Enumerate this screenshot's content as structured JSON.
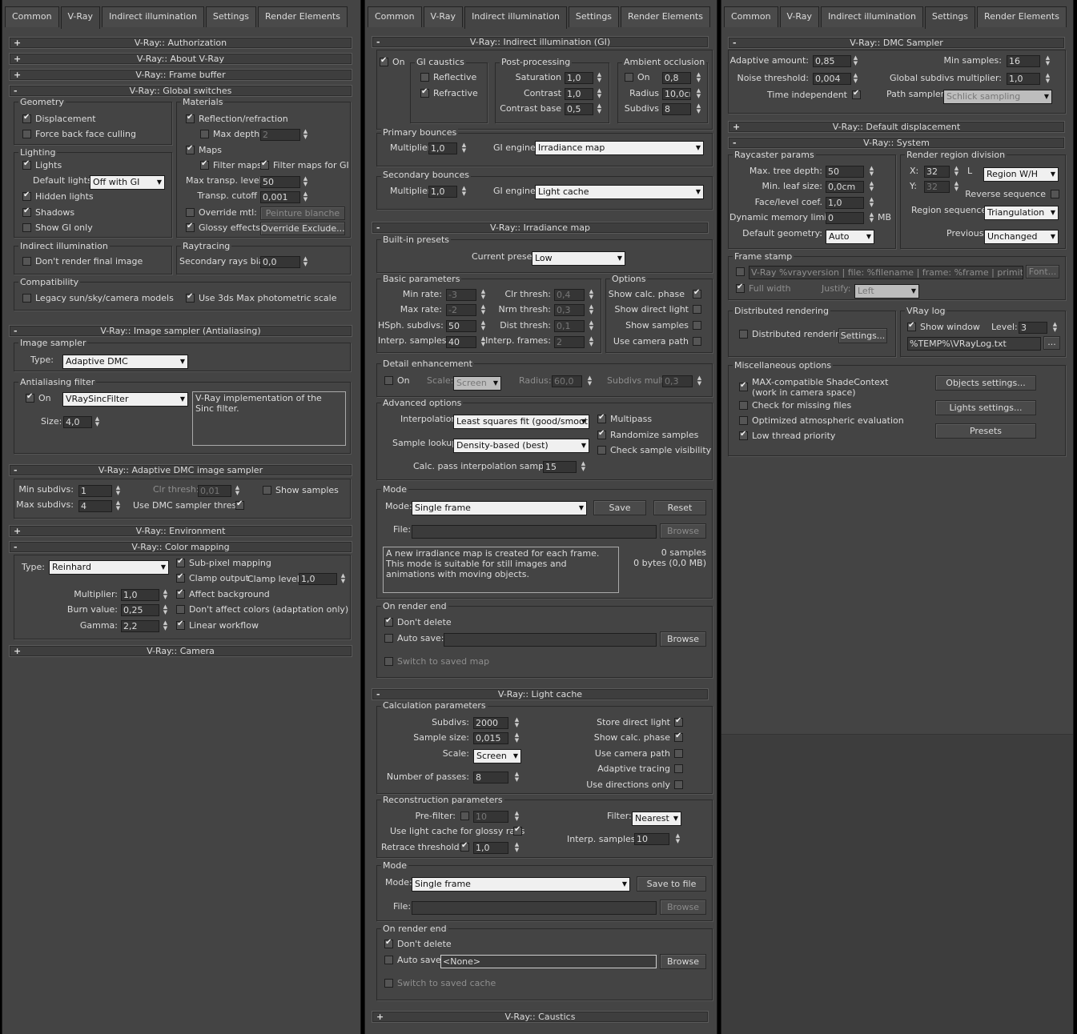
{
  "tabs": [
    "Common",
    "V-Ray",
    "Indirect illumination",
    "Settings",
    "Render Elements"
  ],
  "p1": {
    "rollouts": {
      "auth": "V-Ray:: Authorization",
      "about": "V-Ray:: About V-Ray",
      "fb": "V-Ray:: Frame buffer",
      "gs": "V-Ray:: Global switches",
      "is": "V-Ray:: Image sampler (Antialiasing)",
      "adm": "V-Ray:: Adaptive DMC image sampler",
      "env": "V-Ray:: Environment",
      "cm": "V-Ray:: Color mapping",
      "cam": "V-Ray:: Camera"
    },
    "geometry": "Geometry",
    "displacement": "Displacement",
    "force_back": "Force back face culling",
    "lighting": "Lighting",
    "lights": "Lights",
    "default_lights": "Default lights",
    "default_lights_val": "Off with GI",
    "hidden_lights": "Hidden lights",
    "shadows": "Shadows",
    "show_gi_only": "Show GI only",
    "materials": "Materials",
    "refl_refr": "Reflection/refraction",
    "max_depth": "Max depth",
    "max_depth_val": "2",
    "maps": "Maps",
    "filter_maps": "Filter maps",
    "filter_maps_gi": "Filter maps for GI",
    "max_transp": "Max transp. levels",
    "max_transp_val": "50",
    "transp_cutoff": "Transp. cutoff",
    "transp_cutoff_val": "0,001",
    "override_mtl": "Override mtl:",
    "override_mtl_btn": "Peinture blanche",
    "glossy": "Glossy effects",
    "override_excl": "Override Exclude...",
    "ii": "Indirect illumination",
    "dont_render": "Don't render final image",
    "raytracing": "Raytracing",
    "sec_bias": "Secondary rays bias",
    "sec_bias_val": "0,0",
    "compat": "Compatibility",
    "legacy": "Legacy sun/sky/camera models",
    "use_3ds": "Use 3ds Max photometric scale",
    "image_sampler": "Image sampler",
    "type": "Type:",
    "type_val": "Adaptive DMC",
    "aa_filter": "Antialiasing filter",
    "on": "On",
    "filter_val": "VRaySincFilter",
    "size": "Size:",
    "size_val": "4,0",
    "filter_desc": "V-Ray implementation of the Sinc filter.",
    "min_subdivs": "Min subdivs:",
    "min_subdivs_val": "1",
    "max_subdivs": "Max subdivs:",
    "max_subdivs_val": "4",
    "clr_thresh": "Clr thresh:",
    "clr_thresh_val": "0,01",
    "show_samples": "Show samples",
    "use_dmc": "Use DMC sampler thresh.",
    "cm_type_val": "Reinhard",
    "subpixel": "Sub-pixel mapping",
    "clamp": "Clamp output",
    "clamp_level": "Clamp level:",
    "clamp_level_val": "1,0",
    "multiplier": "Multiplier:",
    "multiplier_val": "1,0",
    "affect_bg": "Affect background",
    "burn": "Burn value:",
    "burn_val": "0,25",
    "dont_affect": "Don't affect colors (adaptation only)",
    "gamma": "Gamma:",
    "gamma_val": "2,2",
    "linear": "Linear workflow"
  },
  "p2": {
    "rollouts": {
      "gi": "V-Ray:: Indirect illumination (GI)",
      "irr": "V-Ray:: Irradiance map",
      "lc": "V-Ray:: Light cache",
      "caus": "V-Ray:: Caustics"
    },
    "on": "On",
    "gi_caustics": "GI caustics",
    "reflective": "Reflective",
    "refractive": "Refractive",
    "post": "Post-processing",
    "saturation": "Saturation",
    "saturation_val": "1,0",
    "contrast": "Contrast",
    "contrast_val": "1,0",
    "contrast_base": "Contrast base",
    "contrast_base_val": "0,5",
    "ao": "Ambient occlusion",
    "ao_on": "On",
    "ao_val": "0,8",
    "radius": "Radius",
    "radius_val": "10,0cm",
    "subdivs": "Subdivs",
    "subdivs_val": "8",
    "primary": "Primary bounces",
    "multiplier": "Multiplier",
    "mult1": "1,0",
    "gi_engine": "GI engine",
    "engine1": "Irradiance map",
    "secondary": "Secondary bounces",
    "mult2": "1,0",
    "engine2": "Light cache",
    "presets": "Built-in presets",
    "current_preset": "Current preset:",
    "preset_val": "Low",
    "basic": "Basic parameters",
    "min_rate": "Min rate:",
    "min_rate_val": "-3",
    "max_rate": "Max rate:",
    "max_rate_val": "-2",
    "hsph": "HSph. subdivs:",
    "hsph_val": "50",
    "interp": "Interp. samples:",
    "interp_val": "40",
    "clr_thresh": "Clr thresh:",
    "clr_thresh_val": "0,4",
    "nrm_thresh": "Nrm thresh:",
    "nrm_thresh_val": "0,3",
    "dist_thresh": "Dist thresh:",
    "dist_thresh_val": "0,1",
    "interp_frames": "Interp. frames:",
    "interp_frames_val": "2",
    "options": "Options",
    "show_calc": "Show calc. phase",
    "show_direct": "Show direct light",
    "show_samples": "Show samples",
    "use_cam": "Use camera path",
    "detail": "Detail enhancement",
    "d_on": "On",
    "scale": "Scale:",
    "scale_val": "Screen",
    "d_radius": "Radius:",
    "d_radius_val": "60,0",
    "subdivs_mult": "Subdivs mult.",
    "subdivs_mult_val": "0,3",
    "advanced": "Advanced options",
    "interpolation": "Interpolation",
    "interp_type": "Least squares fit (good/smooth",
    "multipass": "Multipass",
    "sample_lookup": "Sample lookup:",
    "lookup_val": "Density-based (best)",
    "randomize": "Randomize samples",
    "check_vis": "Check sample visibility",
    "calc_pass": "Calc. pass interpolation samples:",
    "calc_pass_val": "15",
    "mode": "Mode",
    "mode_lbl": "Mode:",
    "mode_val": "Single frame",
    "save": "Save",
    "reset": "Reset",
    "file": "File:",
    "browse": "Browse",
    "mode_desc": "A new irradiance map is created for each frame.\nThis mode is suitable for still images and animations with moving objects.",
    "samples": "0 samples",
    "bytes": "0 bytes (0,0 MB)",
    "ore": "On render end",
    "dont_delete": "Don't delete",
    "auto_save": "Auto save:",
    "switch_map": "Switch to saved map",
    "calc_params": "Calculation parameters",
    "lc_subdivs": "Subdivs:",
    "lc_subdivs_val": "2000",
    "sample_size": "Sample size:",
    "sample_size_val": "0,015",
    "lc_scale": "Scale:",
    "lc_scale_val": "Screen",
    "passes": "Number of passes:",
    "passes_val": "8",
    "store_direct": "Store direct light",
    "lc_show_calc": "Show calc. phase",
    "lc_use_cam": "Use camera path",
    "adaptive": "Adaptive tracing",
    "use_dirs": "Use directions only",
    "recon": "Reconstruction parameters",
    "prefilter": "Pre-filter:",
    "prefilter_val": "10",
    "use_lc_glossy": "Use light cache for glossy rays",
    "retrace": "Retrace threshold:",
    "retrace_val": "1,0",
    "filter": "Filter:",
    "filter_val": "Nearest",
    "interp_samples": "Interp. samples:",
    "interp_samples_val": "10",
    "lc_mode_val": "Single frame",
    "save_file": "Save to file",
    "lc_file": "File:",
    "lc_auto": "Auto save:",
    "lc_auto_val": "<None>",
    "switch_cache": "Switch to saved cache"
  },
  "p3": {
    "rollouts": {
      "dmc": "V-Ray:: DMC Sampler",
      "disp": "V-Ray:: Default displacement",
      "sys": "V-Ray:: System"
    },
    "adaptive_amount": "Adaptive amount:",
    "adaptive_amount_val": "0,85",
    "noise": "Noise threshold:",
    "noise_val": "0,004",
    "time_indep": "Time independent",
    "min_samples": "Min samples:",
    "min_samples_val": "16",
    "global_subdivs": "Global subdivs multiplier:",
    "global_subdivs_val": "1,0",
    "path_sampler": "Path sampler:",
    "path_sampler_val": "Schlick sampling",
    "raycaster": "Raycaster params",
    "max_tree": "Max. tree depth:",
    "max_tree_val": "50",
    "min_leaf": "Min. leaf size:",
    "min_leaf_val": "0,0cm",
    "face_coef": "Face/level coef.",
    "face_coef_val": "1,0",
    "dyn_mem": "Dynamic memory limit:",
    "dyn_mem_val": "0",
    "mb": "MB",
    "default_geo": "Default geometry:",
    "default_geo_val": "Auto",
    "region": "Render region division",
    "x": "X:",
    "x_val": "32",
    "y": "Y:",
    "y_val": "32",
    "l": "L",
    "region_val": "Region W/H",
    "reverse": "Reverse sequence",
    "region_seq": "Region sequence:",
    "region_seq_val": "Triangulation",
    "previous": "Previous",
    "previous_val": "Unchanged",
    "frame_stamp": "Frame stamp",
    "stamp_val": "V-Ray %vrayversion | file: %filename | frame: %frame | primitives: %",
    "font": "Font...",
    "full_width": "Full width",
    "justify": "Justify:",
    "justify_val": "Left",
    "dr": "Distributed rendering",
    "dr_cb": "Distributed rendering",
    "settings": "Settings...",
    "vlog": "VRay log",
    "show_window": "Show window",
    "level": "Level:",
    "level_val": "3",
    "log_path": "%TEMP%\\VRayLog.txt",
    "dots": "...",
    "misc": "Miscellaneous options",
    "max_compat": "MAX-compatible ShadeContext",
    "max_compat2": "(work in camera space)",
    "check_missing": "Check for missing files",
    "optimized": "Optimized atmospheric evaluation",
    "low_thread": "Low thread priority",
    "objects_settings": "Objects settings...",
    "lights_settings": "Lights settings...",
    "presets": "Presets"
  }
}
